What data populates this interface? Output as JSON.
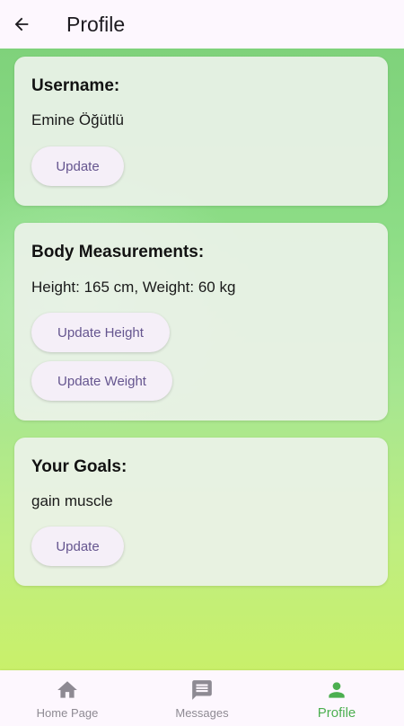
{
  "appbar": {
    "title": "Profile",
    "back_icon": "arrow-back-icon"
  },
  "cards": {
    "username": {
      "title": "Username:",
      "value": "Emine Öğütlü",
      "buttons": [
        "Update"
      ]
    },
    "body": {
      "title": "Body Measurements:",
      "value": "Height: 165 cm, Weight: 60 kg",
      "buttons": [
        "Update Height",
        "Update Weight"
      ]
    },
    "goals": {
      "title": "Your Goals:",
      "value": "gain muscle",
      "buttons": [
        "Update"
      ]
    }
  },
  "nav": {
    "items": [
      {
        "label": "Home Page",
        "icon": "home-icon",
        "active": false
      },
      {
        "label": "Messages",
        "icon": "message-icon",
        "active": false
      },
      {
        "label": "Profile",
        "icon": "person-icon",
        "active": true
      }
    ]
  },
  "colors": {
    "accent": "#4caf50",
    "button_text": "#65558f",
    "inactive": "#8e8a93"
  }
}
